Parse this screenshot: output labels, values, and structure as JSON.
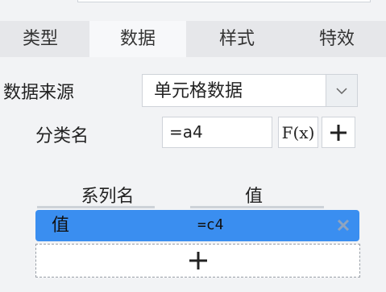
{
  "tabs": [
    {
      "label": "类型"
    },
    {
      "label": "数据"
    },
    {
      "label": "样式"
    },
    {
      "label": "特效"
    }
  ],
  "data_source": {
    "label": "数据来源",
    "value": "单元格数据",
    "dropdown_icon": "chevron-down-icon"
  },
  "category": {
    "label": "分类名",
    "value": "=a4",
    "fx_label": "F(x)",
    "add_icon": "plus-icon"
  },
  "series": {
    "headers": {
      "name": "系列名",
      "value": "值"
    },
    "rows": [
      {
        "name": "值",
        "value": "=c4"
      }
    ],
    "add_icon": "plus-icon",
    "row_color": "#3a8ef0"
  }
}
